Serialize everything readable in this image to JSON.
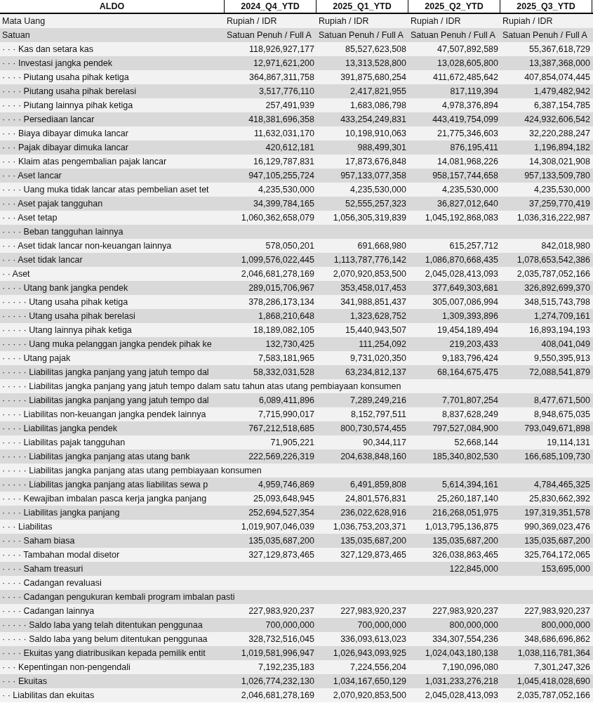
{
  "table": {
    "title": "ALDO",
    "columns": [
      "2024_Q4_YTD",
      "2025_Q1_YTD",
      "2025_Q2_YTD",
      "2025_Q3_YTD"
    ],
    "meta_rows": [
      {
        "label": "Mata Uang",
        "values": [
          "Rupiah / IDR",
          "Rupiah / IDR",
          "Rupiah / IDR",
          "Rupiah / IDR"
        ]
      },
      {
        "label": "Satuan",
        "values": [
          "Satuan Penuh / Full A",
          "Satuan Penuh / Full A",
          "Satuan Penuh / Full A",
          "Satuan Penuh / Full A"
        ]
      }
    ],
    "rows": [
      {
        "label": "· · · Kas dan setara kas",
        "values": [
          "118,926,927,177",
          "85,527,623,508",
          "47,507,892,589",
          "55,367,618,729"
        ]
      },
      {
        "label": "· · · Investasi jangka pendek",
        "values": [
          "12,971,621,200",
          "13,313,528,800",
          "13,028,605,800",
          "13,387,368,000"
        ]
      },
      {
        "label": "· · · · Piutang usaha pihak ketiga",
        "values": [
          "364,867,311,758",
          "391,875,680,254",
          "411,672,485,642",
          "407,854,074,445"
        ]
      },
      {
        "label": "· · · · Piutang usaha pihak berelasi",
        "values": [
          "3,517,776,110",
          "2,417,821,955",
          "817,119,394",
          "1,479,482,942"
        ]
      },
      {
        "label": "· · · · Piutang lainnya pihak ketiga",
        "values": [
          "257,491,939",
          "1,683,086,798",
          "4,978,376,894",
          "6,387,154,785"
        ]
      },
      {
        "label": "· · · · Persediaan lancar",
        "values": [
          "418,381,696,358",
          "433,254,249,831",
          "443,419,754,099",
          "424,932,606,542"
        ]
      },
      {
        "label": "· · · Biaya dibayar dimuka lancar",
        "values": [
          "11,632,031,170",
          "10,198,910,063",
          "21,775,346,603",
          "32,220,288,247"
        ]
      },
      {
        "label": "· · · Pajak dibayar dimuka lancar",
        "values": [
          "420,612,181",
          "988,499,301",
          "876,195,411",
          "1,196,894,182"
        ]
      },
      {
        "label": "· · · Klaim atas pengembalian pajak lancar",
        "values": [
          "16,129,787,831",
          "17,873,676,848",
          "14,081,968,226",
          "14,308,021,908"
        ]
      },
      {
        "label": "· · · Aset lancar",
        "values": [
          "947,105,255,724",
          "957,133,077,358",
          "958,157,744,658",
          "957,133,509,780"
        ]
      },
      {
        "label": "· · · · Uang muka tidak lancar atas pembelian aset tet",
        "values": [
          "4,235,530,000",
          "4,235,530,000",
          "4,235,530,000",
          "4,235,530,000"
        ]
      },
      {
        "label": "· · · Aset pajak tangguhan",
        "values": [
          "34,399,784,165",
          "52,555,257,323",
          "36,827,012,640",
          "37,259,770,419"
        ]
      },
      {
        "label": "· · · Aset tetap",
        "values": [
          "1,060,362,658,079",
          "1,056,305,319,839",
          "1,045,192,868,083",
          "1,036,316,222,987"
        ]
      },
      {
        "label": "· · · · Beban tangguhan lainnya"
      },
      {
        "label": "· · · Aset tidak lancar non-keuangan lainnya",
        "values": [
          "578,050,201",
          "691,668,980",
          "615,257,712",
          "842,018,980"
        ]
      },
      {
        "label": "· · · Aset tidak lancar",
        "values": [
          "1,099,576,022,445",
          "1,113,787,776,142",
          "1,086,870,668,435",
          "1,078,653,542,386"
        ]
      },
      {
        "label": "· · Aset",
        "values": [
          "2,046,681,278,169",
          "2,070,920,853,500",
          "2,045,028,413,093",
          "2,035,787,052,166"
        ]
      },
      {
        "label": "· · · · Utang bank jangka pendek",
        "values": [
          "289,015,706,967",
          "353,458,017,453",
          "377,649,303,681",
          "326,892,699,370"
        ]
      },
      {
        "label": "· · · · · Utang usaha pihak ketiga",
        "values": [
          "378,286,173,134",
          "341,988,851,437",
          "305,007,086,994",
          "348,515,743,798"
        ]
      },
      {
        "label": "· · · · · Utang usaha pihak berelasi",
        "values": [
          "1,868,210,648",
          "1,323,628,752",
          "1,309,393,896",
          "1,274,709,161"
        ]
      },
      {
        "label": "· · · · · Utang lainnya pihak ketiga",
        "values": [
          "18,189,082,105",
          "15,440,943,507",
          "19,454,189,494",
          "16,893,194,193"
        ]
      },
      {
        "label": "· · · · · Uang muka pelanggan jangka pendek pihak ke",
        "values": [
          "132,730,425",
          "111,254,092",
          "219,203,433",
          "408,041,049"
        ]
      },
      {
        "label": "· · · · Utang pajak",
        "values": [
          "7,583,181,965",
          "9,731,020,350",
          "9,183,796,424",
          "9,550,395,913"
        ]
      },
      {
        "label": "· · · · · Liabilitas jangka panjang yang jatuh tempo dal",
        "values": [
          "58,332,031,528",
          "63,234,812,137",
          "68,164,675,475",
          "72,088,541,879"
        ]
      },
      {
        "label": "· · · · · Liabilitas jangka panjang yang jatuh tempo dalam satu tahun atas utang pembiayaan konsumen"
      },
      {
        "label": "· · · · · Liabilitas jangka panjang yang jatuh tempo dal",
        "values": [
          "6,089,411,896",
          "7,289,249,216",
          "7,701,807,254",
          "8,477,671,500"
        ]
      },
      {
        "label": "· · · · Liabilitas non-keuangan jangka pendek lainnya",
        "values": [
          "7,715,990,017",
          "8,152,797,511",
          "8,837,628,249",
          "8,948,675,035"
        ]
      },
      {
        "label": "· · · · Liabilitas jangka pendek",
        "values": [
          "767,212,518,685",
          "800,730,574,455",
          "797,527,084,900",
          "793,049,671,898"
        ]
      },
      {
        "label": "· · · · Liabilitas pajak tangguhan",
        "values": [
          "71,905,221",
          "90,344,117",
          "52,668,144",
          "19,114,131"
        ]
      },
      {
        "label": "· · · · · Liabilitas jangka panjang atas utang bank",
        "values": [
          "222,569,226,319",
          "204,638,848,160",
          "185,340,802,530",
          "166,685,109,730"
        ]
      },
      {
        "label": "· · · · · Liabilitas jangka panjang atas utang pembiayaan konsumen"
      },
      {
        "label": "· · · · · Liabilitas jangka panjang atas liabilitas sewa p",
        "values": [
          "4,959,746,869",
          "6,491,859,808",
          "5,614,394,161",
          "4,784,465,325"
        ]
      },
      {
        "label": "· · · · Kewajiban imbalan pasca kerja jangka panjang",
        "values": [
          "25,093,648,945",
          "24,801,576,831",
          "25,260,187,140",
          "25,830,662,392"
        ]
      },
      {
        "label": "· · · · Liabilitas jangka panjang",
        "values": [
          "252,694,527,354",
          "236,022,628,916",
          "216,268,051,975",
          "197,319,351,578"
        ]
      },
      {
        "label": "· · · Liabilitas",
        "values": [
          "1,019,907,046,039",
          "1,036,753,203,371",
          "1,013,795,136,875",
          "990,369,023,476"
        ]
      },
      {
        "label": "· · · · Saham biasa",
        "values": [
          "135,035,687,200",
          "135,035,687,200",
          "135,035,687,200",
          "135,035,687,200"
        ]
      },
      {
        "label": "· · · · Tambahan modal disetor",
        "values": [
          "327,129,873,465",
          "327,129,873,465",
          "326,038,863,465",
          "325,764,172,065"
        ]
      },
      {
        "label": "· · · · Saham treasuri",
        "values": [
          "122,845,000",
          "153,695,000"
        ]
      },
      {
        "label": "· · · · Cadangan revaluasi"
      },
      {
        "label": "· · · · Cadangan pengukuran kembali program imbalan pasti"
      },
      {
        "label": "· · · · Cadangan lainnya",
        "values": [
          "227,983,920,237",
          "227,983,920,237",
          "227,983,920,237",
          "227,983,920,237"
        ]
      },
      {
        "label": "· · · · · Saldo laba yang telah ditentukan penggunaa",
        "values": [
          "700,000,000",
          "700,000,000",
          "800,000,000",
          "800,000,000"
        ]
      },
      {
        "label": "· · · · · Saldo laba yang belum ditentukan penggunaa",
        "values": [
          "328,732,516,045",
          "336,093,613,023",
          "334,307,554,236",
          "348,686,696,862"
        ]
      },
      {
        "label": "· · · · Ekuitas yang diatribusikan kepada pemilik entit",
        "values": [
          "1,019,581,996,947",
          "1,026,943,093,925",
          "1,024,043,180,138",
          "1,038,116,781,364"
        ]
      },
      {
        "label": "· · · Kepentingan non-pengendali",
        "values": [
          "7,192,235,183",
          "7,224,556,204",
          "7,190,096,080",
          "7,301,247,326"
        ]
      },
      {
        "label": "· · · Ekuitas",
        "values": [
          "1,026,774,232,130",
          "1,034,167,650,129",
          "1,031,233,276,218",
          "1,045,418,028,690"
        ]
      },
      {
        "label": "· · Liabilitas dan ekuitas",
        "values": [
          "2,046,681,278,169",
          "2,070,920,853,500",
          "2,045,028,413,093",
          "2,035,787,052,166"
        ]
      }
    ]
  }
}
